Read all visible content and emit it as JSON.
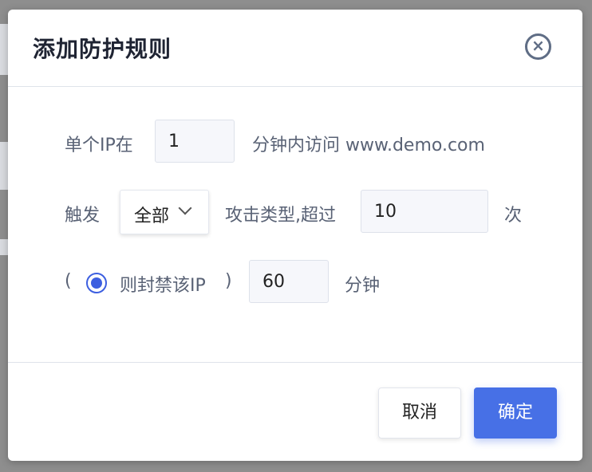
{
  "modal": {
    "title": "添加防护规则",
    "close_glyph": "×"
  },
  "rule": {
    "prefix": "单个IP在",
    "minutes_value": "1",
    "suffix": "分钟内访问 www.demo.com",
    "trigger_label": "触发",
    "attack_type": {
      "selected": "全部"
    },
    "attack_text": "攻击类型,超过",
    "count_value": "10",
    "count_unit": "次",
    "paren_open": "(",
    "block_label": "则封禁该IP",
    "paren_close": ")",
    "block_minutes_value": "60",
    "block_unit": "分钟"
  },
  "footer": {
    "cancel_label": "取消",
    "confirm_label": "确定"
  },
  "colors": {
    "accent": "#4770e6",
    "radio": "#3d5fe0",
    "title_text": "#1f2433",
    "body_text": "#596275"
  },
  "icons": {
    "close": "close-icon",
    "dropdown": "chevron-down-icon"
  }
}
